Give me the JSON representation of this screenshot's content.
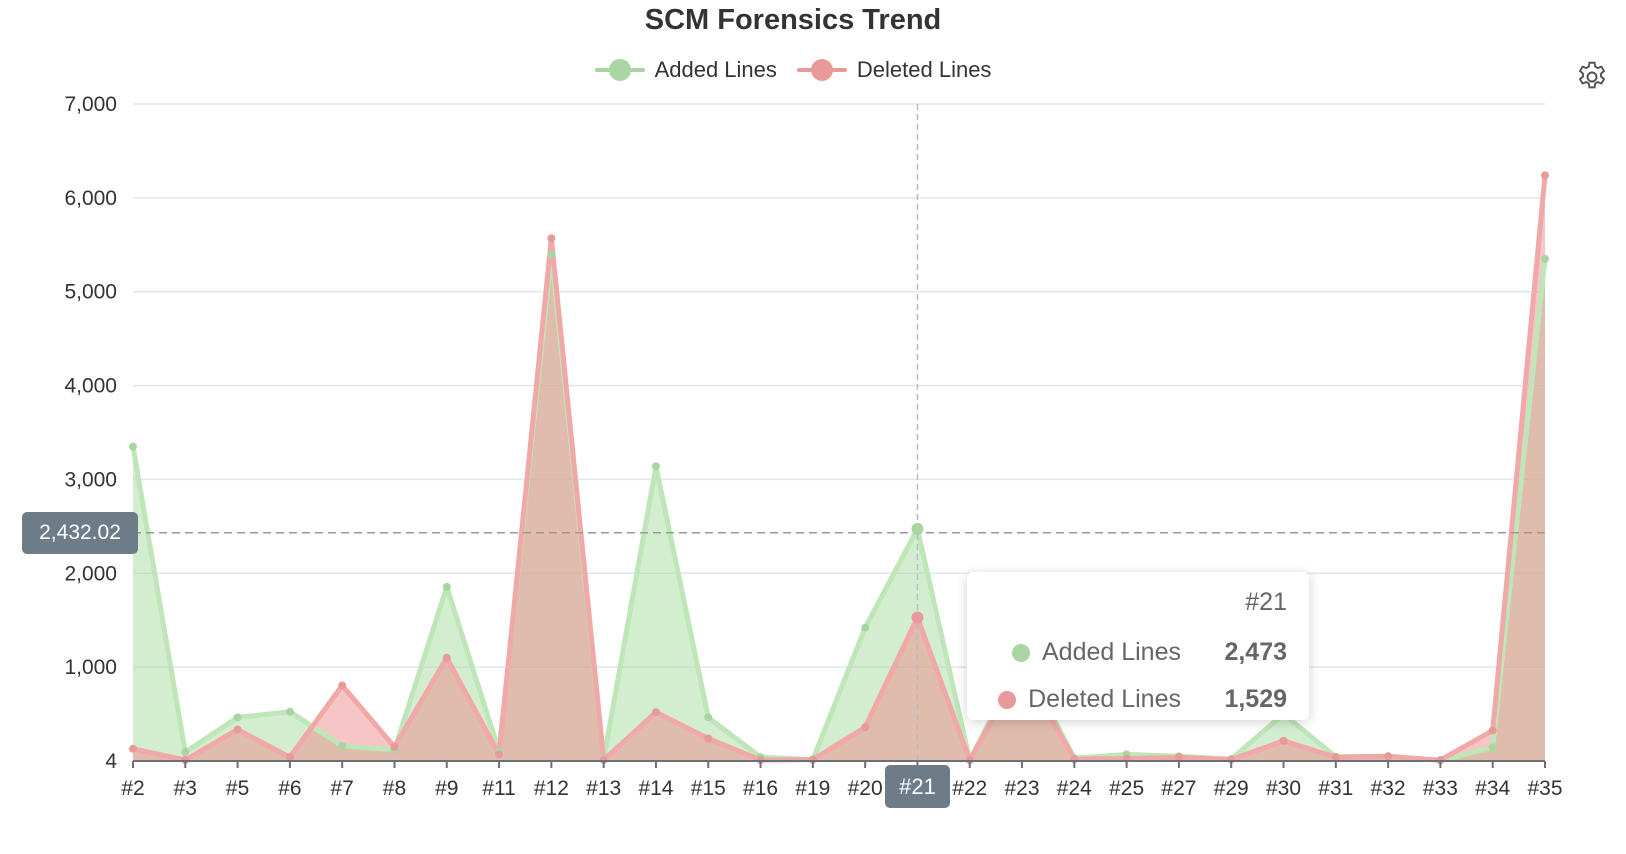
{
  "chart_data": {
    "type": "area",
    "title": "SCM Forensics Trend",
    "xlabel": "",
    "ylabel": "",
    "categories": [
      "#2",
      "#3",
      "#5",
      "#6",
      "#7",
      "#8",
      "#9",
      "#11",
      "#12",
      "#13",
      "#14",
      "#15",
      "#16",
      "#19",
      "#20",
      "#21",
      "#22",
      "#23",
      "#24",
      "#25",
      "#27",
      "#29",
      "#30",
      "#31",
      "#32",
      "#33",
      "#34",
      "#35"
    ],
    "series": [
      {
        "name": "Added Lines",
        "color": "#a8d5a2",
        "values": [
          3350,
          95,
          465,
          525,
          160,
          120,
          1855,
          105,
          5400,
          20,
          3140,
          465,
          40,
          15,
          1420,
          2473,
          10,
          1100,
          30,
          70,
          50,
          20,
          500,
          45,
          50,
          5,
          145,
          5350
        ]
      },
      {
        "name": "Deleted Lines",
        "color": "#e89a9a",
        "values": [
          130,
          10,
          335,
          40,
          805,
          150,
          1100,
          70,
          5570,
          10,
          520,
          240,
          10,
          15,
          360,
          1529,
          10,
          1000,
          20,
          25,
          40,
          15,
          215,
          40,
          50,
          10,
          325,
          6240
        ]
      }
    ],
    "ylim": [
      4,
      7000
    ],
    "yticks": [
      "4",
      "1,000",
      "2,000",
      "3,000",
      "4,000",
      "5,000",
      "6,000",
      "7,000"
    ],
    "ytick_values": [
      4,
      1000,
      2000,
      3000,
      4000,
      5000,
      6000,
      7000
    ],
    "grid": true,
    "legend_position": "top-center",
    "crosshair": {
      "x_label": "#21",
      "y_label": "2,432.02",
      "y_value": 2432.02
    },
    "tooltip": {
      "title": "#21",
      "rows": [
        {
          "name": "Added Lines",
          "value": "2,473"
        },
        {
          "name": "Deleted Lines",
          "value": "1,529"
        }
      ]
    }
  },
  "toolbar": {
    "settings_icon": "gear-icon"
  }
}
